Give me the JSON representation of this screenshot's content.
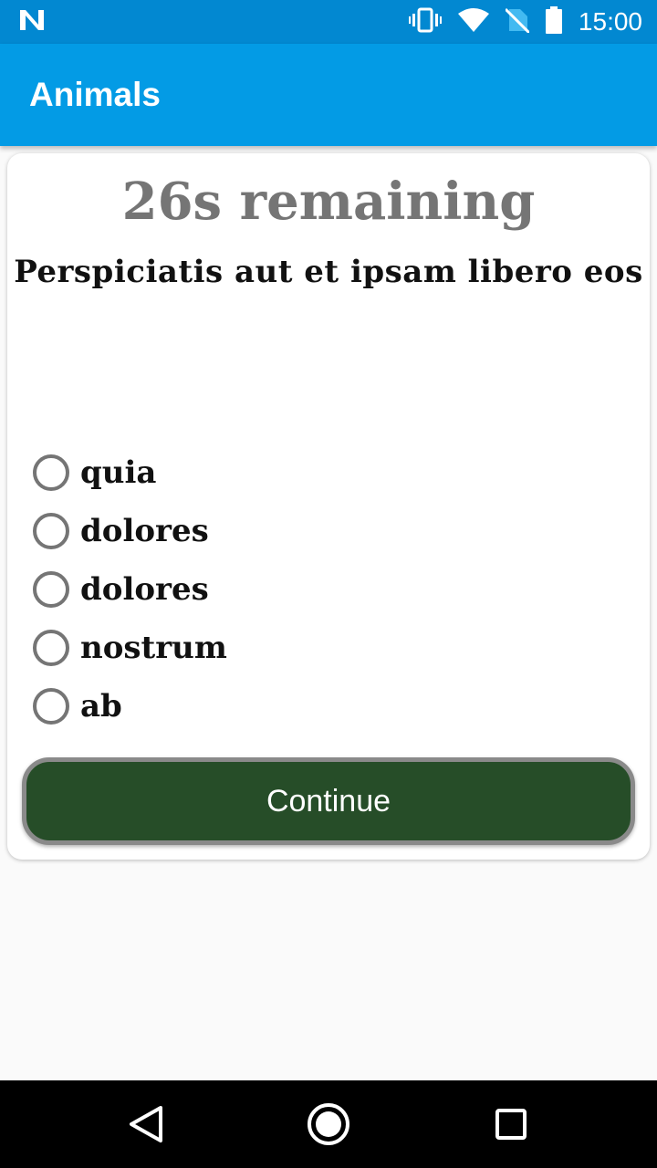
{
  "status_bar": {
    "time": "15:00",
    "icons": [
      "notification-n-icon",
      "vibrate-icon",
      "wifi-icon",
      "no-sim-icon",
      "battery-icon"
    ]
  },
  "app_bar": {
    "title": "Animals"
  },
  "quiz": {
    "timer_text": "26s remaining",
    "question": "Perspiciatis aut et ipsam libero eos",
    "options": [
      "quia",
      "dolores",
      "dolores",
      "nostrum",
      "ab"
    ],
    "continue_label": "Continue"
  },
  "colors": {
    "status_bar": "#0288d1",
    "app_bar": "#039be5",
    "continue_button": "#264d28"
  }
}
